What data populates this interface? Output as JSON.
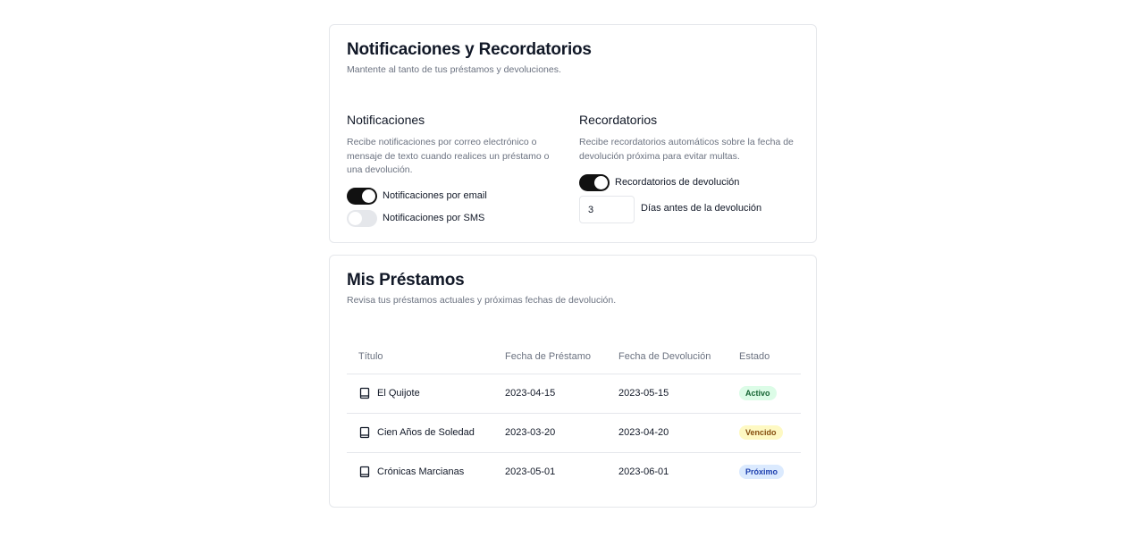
{
  "notifications_card": {
    "title": "Notificaciones y Recordatorios",
    "description": "Mantente al tanto de tus préstamos y devoluciones.",
    "notifications": {
      "title": "Notificaciones",
      "description": "Recibe notificaciones por correo electrónico o mensaje de texto cuando realices un préstamo o una devolución.",
      "email_label": "Notificaciones por email",
      "email_enabled": true,
      "sms_label": "Notificaciones por SMS",
      "sms_enabled": false
    },
    "reminders": {
      "title": "Recordatorios",
      "description": "Recibe recordatorios automáticos sobre la fecha de devolución próxima para evitar multas.",
      "return_reminder_label": "Recordatorios de devolución",
      "return_reminder_enabled": true,
      "days_value": "3",
      "days_label": "Días antes de la devolución"
    }
  },
  "loans_card": {
    "title": "Mis Préstamos",
    "description": "Revisa tus préstamos actuales y próximas fechas de devolución.",
    "columns": [
      "Título",
      "Fecha de Préstamo",
      "Fecha de Devolución",
      "Estado"
    ],
    "rows": [
      {
        "title": "El Quijote",
        "loan_date": "2023-04-15",
        "return_date": "2023-05-15",
        "status": "Activo",
        "status_color": "#166534",
        "status_bg": "#dcfce7",
        "icon": "book-icon"
      },
      {
        "title": "Cien Años de Soledad",
        "loan_date": "2023-03-20",
        "return_date": "2023-04-20",
        "status": "Vencido",
        "status_color": "#854d0e",
        "status_bg": "#fef9c3",
        "icon": "book-icon"
      },
      {
        "title": "Crónicas Marcianas",
        "loan_date": "2023-05-01",
        "return_date": "2023-06-01",
        "status": "Próximo",
        "status_color": "#1e40af",
        "status_bg": "#dbeafe",
        "icon": "book-icon"
      }
    ]
  },
  "colors": {
    "switch_on": "#111111",
    "switch_off": "#e5e7eb",
    "border": "#e5e7eb",
    "muted_text": "#6b7280"
  }
}
